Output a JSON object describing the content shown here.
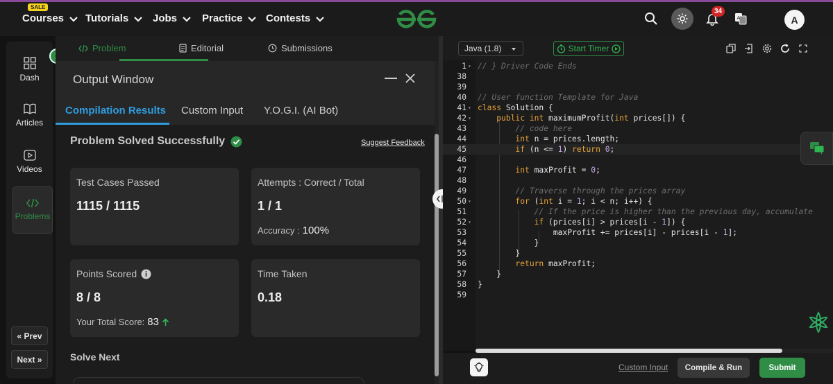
{
  "nav": {
    "sale_badge": "SALE",
    "items": [
      {
        "label": "Courses"
      },
      {
        "label": "Tutorials"
      },
      {
        "label": "Jobs"
      },
      {
        "label": "Practice"
      },
      {
        "label": "Contests"
      }
    ],
    "notification_count": "34",
    "avatar_initial": "A",
    "icons": [
      "search-icon",
      "theme-toggle-icon",
      "bell-icon",
      "translate-icon"
    ]
  },
  "sidebar": {
    "items": [
      {
        "label": "Dash",
        "icon": "dashboard-icon"
      },
      {
        "label": "Articles",
        "icon": "book-icon"
      },
      {
        "label": "Videos",
        "icon": "play-icon"
      },
      {
        "label": "Problems",
        "icon": "code-icon"
      }
    ],
    "prev_label": "« Prev",
    "next_label": "Next »"
  },
  "problem_tabs": [
    {
      "label": "Problem",
      "icon": "code-icon"
    },
    {
      "label": "Editorial",
      "icon": "document-icon"
    },
    {
      "label": "Submissions",
      "icon": "clock-icon"
    }
  ],
  "output": {
    "title": "Output Window",
    "tabs": [
      "Compilation Results",
      "Custom Input",
      "Y.O.G.I. (AI Bot)"
    ],
    "status": "Problem Solved Successfully",
    "feedback_link": "Suggest Feedback",
    "cards": {
      "test_cases": {
        "label": "Test Cases Passed",
        "value": "1115 / 1115"
      },
      "attempts": {
        "label": "Attempts : Correct / Total",
        "value": "1 / 1",
        "sub_label": "Accuracy :",
        "sub_value": "100%"
      },
      "points": {
        "label": "Points Scored",
        "value": "8 / 8",
        "sub_label": "Your Total Score:",
        "sub_value": "83"
      },
      "time": {
        "label": "Time Taken",
        "value": "0.18"
      }
    },
    "solve_next": "Solve Next"
  },
  "editor": {
    "language": "Java (1.8)",
    "timer_label": "Start Timer",
    "custom_input_label": "Custom Input",
    "compile_label": "Compile & Run",
    "submit_label": "Submit",
    "lines": [
      {
        "n": "1",
        "code": "// } Driver Code Ends",
        "fold": true
      },
      {
        "n": "38",
        "code": ""
      },
      {
        "n": "39",
        "code": ""
      },
      {
        "n": "40",
        "code": "// User function Template for Java"
      },
      {
        "n": "41",
        "code": "class Solution {",
        "fold": true
      },
      {
        "n": "42",
        "code": "    public int maximumProfit(int prices[]) {",
        "fold": true
      },
      {
        "n": "43",
        "code": "        // code here"
      },
      {
        "n": "44",
        "code": "        int n = prices.length;"
      },
      {
        "n": "45",
        "code": "        if (n <= 1) return 0;"
      },
      {
        "n": "46",
        "code": ""
      },
      {
        "n": "47",
        "code": "        int maxProfit = 0;"
      },
      {
        "n": "48",
        "code": ""
      },
      {
        "n": "49",
        "code": "        // Traverse through the prices array"
      },
      {
        "n": "50",
        "code": "        for (int i = 1; i < n; i++) {",
        "fold": true
      },
      {
        "n": "51",
        "code": "            // If the price is higher than the previous day, accumulate"
      },
      {
        "n": "52",
        "code": "            if (prices[i] > prices[i - 1]) {",
        "fold": true
      },
      {
        "n": "53",
        "code": "                maxProfit += prices[i] - prices[i - 1];"
      },
      {
        "n": "54",
        "code": "            }"
      },
      {
        "n": "55",
        "code": "        }"
      },
      {
        "n": "56",
        "code": "        return maxProfit;"
      },
      {
        "n": "57",
        "code": "    }"
      },
      {
        "n": "58",
        "code": "}"
      },
      {
        "n": "59",
        "code": ""
      }
    ]
  },
  "colors": {
    "accent_green": "#2f8d46",
    "tab_blue": "#2f9de0",
    "keyword": "#e8a33a",
    "comment": "#6e6e6e",
    "number": "#c6a6e6"
  }
}
